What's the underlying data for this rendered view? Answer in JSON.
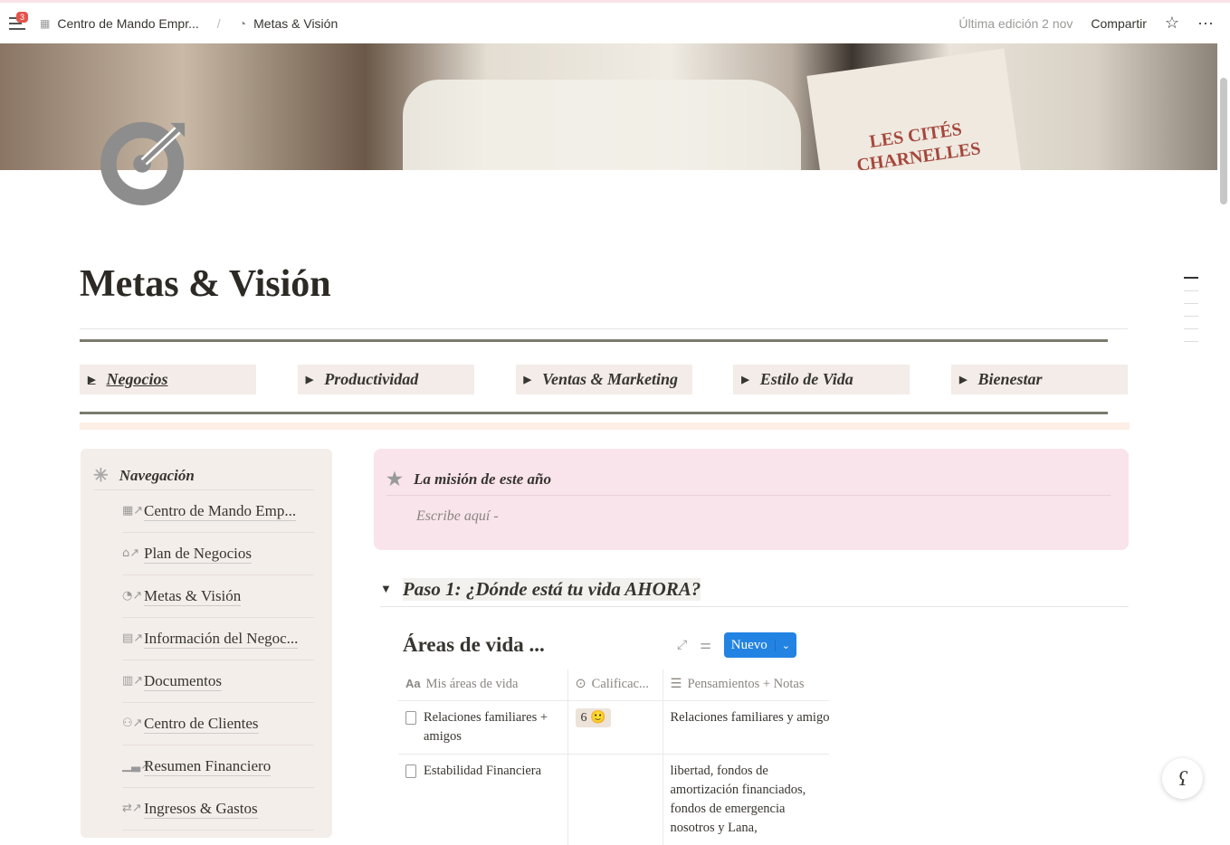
{
  "topbar": {
    "notifications": "3",
    "breadcrumb": [
      "Centro de Mando Empr...",
      "Metas & Visión"
    ],
    "last_edit": "Última edición 2 nov",
    "share": "Compartir"
  },
  "cover": {
    "book_text": "LES CITÉS CHARNELLES"
  },
  "page": {
    "title": "Metas & Visión"
  },
  "toggles": [
    "Negocios",
    "Productividad",
    "Ventas & Marketing",
    "Estilo de Vida",
    "Bienestar"
  ],
  "nav": {
    "title": "Navegación",
    "items": [
      "Centro de Mando Emp...",
      "Plan de Negocios",
      "Metas & Visión",
      "Información del Negoc...",
      "Documentos",
      "Centro de Clientes",
      "Resumen Financiero",
      "Ingresos & Gastos"
    ]
  },
  "mission": {
    "title": "La misión de este año",
    "placeholder": "Escribe aquí -"
  },
  "step1": {
    "title": "Paso 1: ¿Dónde está tu vida AHORA?"
  },
  "database": {
    "title": "Áreas de vida ...",
    "new_label": "Nuevo",
    "columns": [
      "Mis áreas de vida",
      "Calificac...",
      "Pensamientos + Notas"
    ],
    "rows": [
      {
        "area": "Relaciones familiares + amigos",
        "rating": "6 🙂",
        "notes": "Relaciones familiares y amigos"
      },
      {
        "area": "Estabilidad Financiera",
        "rating": "",
        "notes": "libertad, fondos de amortización financiados, fondos de emergencia nosotros y Lana,"
      }
    ]
  }
}
